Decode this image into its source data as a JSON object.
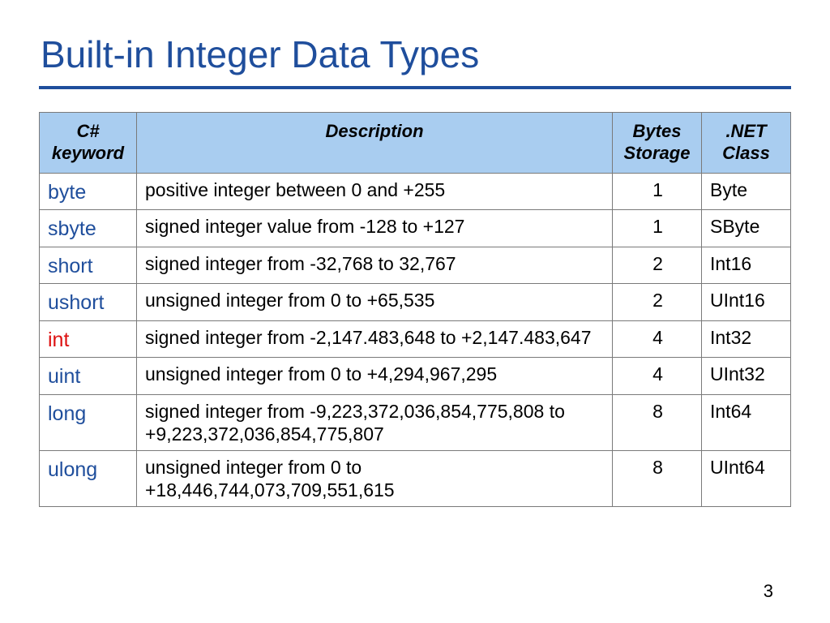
{
  "title": "Built-in Integer Data Types",
  "page_number": "3",
  "headers": {
    "keyword": "C# keyword",
    "description": "Description",
    "bytes": "Bytes Storage",
    "netclass": ".NET Class"
  },
  "rows": [
    {
      "keyword": "byte",
      "highlight": false,
      "description": "positive integer between 0 and +255",
      "bytes": "1",
      "netclass": "Byte"
    },
    {
      "keyword": "sbyte",
      "highlight": false,
      "description": "signed integer value from -128 to +127",
      "bytes": "1",
      "netclass": "SByte"
    },
    {
      "keyword": "short",
      "highlight": false,
      "description": "signed integer from -32,768 to 32,767",
      "bytes": "2",
      "netclass": "Int16"
    },
    {
      "keyword": "ushort",
      "highlight": false,
      "description": "unsigned integer from 0 to +65,535",
      "bytes": "2",
      "netclass": "UInt16"
    },
    {
      "keyword": "int",
      "highlight": true,
      "description": "signed integer from -2,147.483,648 to +2,147.483,647",
      "bytes": "4",
      "netclass": "Int32"
    },
    {
      "keyword": "uint",
      "highlight": false,
      "description": "unsigned integer from 0 to +4,294,967,295",
      "bytes": "4",
      "netclass": "UInt32"
    },
    {
      "keyword": "long",
      "highlight": false,
      "description": "signed integer from -9,223,372,036,854,775,808 to +9,223,372,036,854,775,807",
      "bytes": "8",
      "netclass": "Int64"
    },
    {
      "keyword": "ulong",
      "highlight": false,
      "description": "unsigned integer from 0 to +18,446,744,073,709,551,615",
      "bytes": "8",
      "netclass": "UInt64"
    }
  ]
}
